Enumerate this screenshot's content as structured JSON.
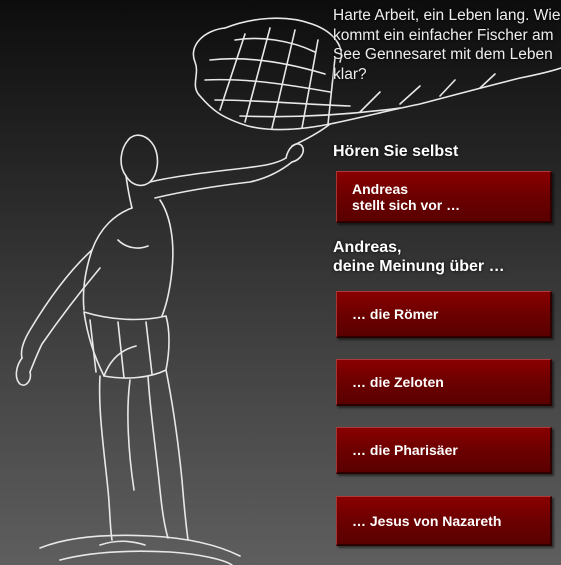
{
  "intro_text": "Harte Arbeit, ein Leben lang. Wie kommt ein einfacher Fischer am See Gennesaret mit dem Leben klar?",
  "listen_heading": "Hören Sie selbst",
  "intro_button": {
    "line1": "Andreas",
    "line2": "stellt sich vor …"
  },
  "opinion_heading": {
    "line1": "Andreas,",
    "line2": "deine Meinung über …"
  },
  "topics": [
    {
      "label": "… die Römer"
    },
    {
      "label": "… die Zeloten"
    },
    {
      "label": "… die Pharisäer"
    },
    {
      "label": "… Jesus von Nazareth"
    }
  ],
  "colors": {
    "button": "#7a0000",
    "background_top": "#0d0d0d",
    "background_bottom": "#5e5e5e"
  },
  "icons": {
    "illustration": "fisherman-casting-net-drawing"
  }
}
